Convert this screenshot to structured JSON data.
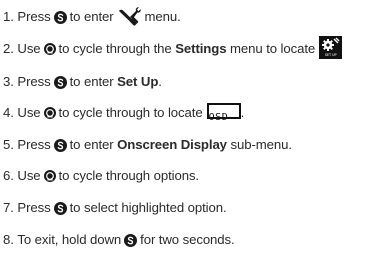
{
  "steps": [
    {
      "num": "1.",
      "parts": [
        "Press",
        "to enter",
        "menu."
      ]
    },
    {
      "num": "2.",
      "parts": [
        "Use",
        "to cycle through the",
        "Settings",
        "menu to locate"
      ]
    },
    {
      "num": "3.",
      "parts": [
        "Press",
        "to enter",
        "Set Up",
        "."
      ]
    },
    {
      "num": "4.",
      "parts": [
        "Use",
        "to cycle through to locate",
        "."
      ]
    },
    {
      "num": "5.",
      "parts": [
        "Press",
        "to enter",
        "Onscreen Display",
        "sub-menu."
      ]
    },
    {
      "num": "6.",
      "parts": [
        "Use",
        "to cycle through options."
      ]
    },
    {
      "num": "7.",
      "parts": [
        "Press",
        "to select highlighted option."
      ]
    },
    {
      "num": "8.",
      "parts": [
        "To exit, hold down",
        "for two seconds."
      ]
    }
  ],
  "icons": {
    "select_button": "s-button-icon",
    "dial_button": "dial-button-icon",
    "wrench": "wrench-icon",
    "setup": "setup-icon",
    "osd": "osd-icon"
  },
  "osd_label": "OSD",
  "setup_label": "SET UP",
  "colors": {
    "text": "#2b2b2b",
    "icon": "#1a1a1a"
  }
}
